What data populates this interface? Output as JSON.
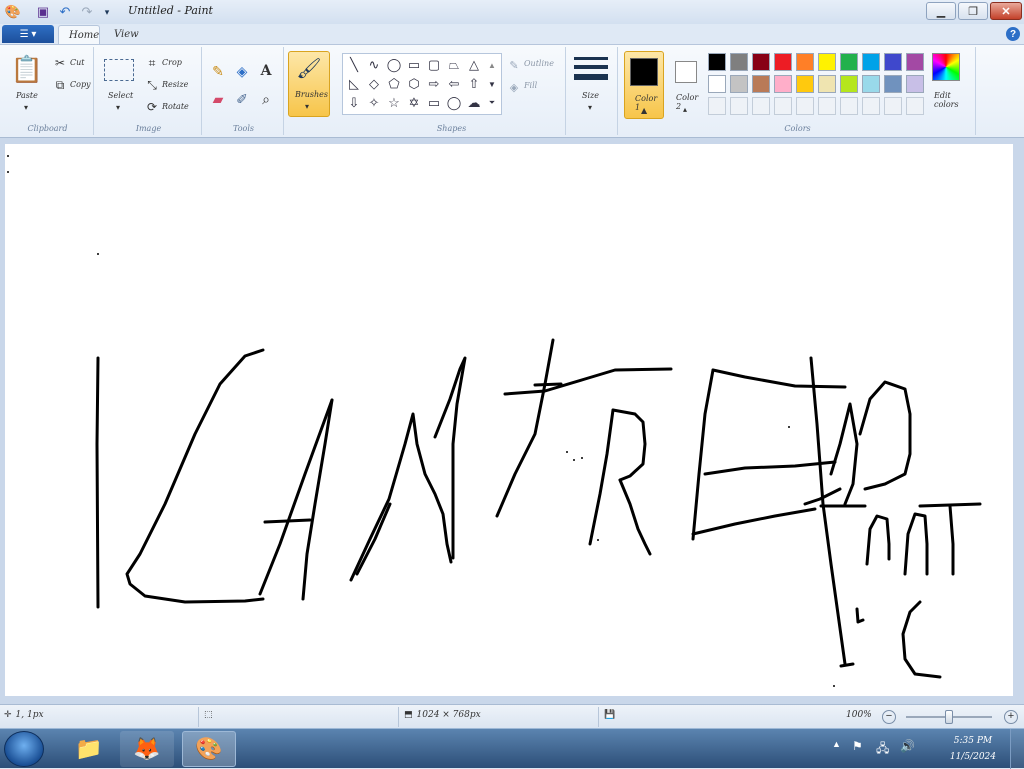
{
  "window": {
    "title": "Untitled - Paint"
  },
  "tabs": [
    {
      "label": "Home"
    },
    {
      "label": "View"
    }
  ],
  "ribbon": {
    "clipboard": {
      "paste": "Paste",
      "cut": "Cut",
      "copy": "Copy",
      "group": "Clipboard"
    },
    "image": {
      "select": "Select",
      "crop": "Crop",
      "resize": "Resize",
      "rotate": "Rotate",
      "group": "Image"
    },
    "tools": {
      "group": "Tools"
    },
    "brushes": {
      "label": "Brushes"
    },
    "shapes": {
      "outline": "Outline",
      "fill": "Fill",
      "group": "Shapes"
    },
    "size": {
      "label": "Size"
    },
    "colors": {
      "color1": "Color 1",
      "color2": "Color 2",
      "edit": "Edit colors",
      "group": "Colors",
      "palette_row1": [
        "#000000",
        "#7f7f7f",
        "#880015",
        "#ed1c24",
        "#ff7f27",
        "#fff200",
        "#22b14c",
        "#00a2e8",
        "#3f48cc",
        "#a349a4"
      ],
      "palette_row2": [
        "#ffffff",
        "#c3c3c3",
        "#b97a57",
        "#ffaec9",
        "#ffc90e",
        "#efe4b0",
        "#b5e61d",
        "#99d9ea",
        "#7092be",
        "#c8bfe7"
      ],
      "active_color1": "#000000",
      "active_color2": "#ffffff"
    }
  },
  "statusbar": {
    "cursor_pos": "1, 1px",
    "selection_size": "1024 × 768px",
    "zoom": "100%"
  },
  "taskbar": {
    "apps": [
      "Windows Explorer",
      "Firefox",
      "Paint"
    ],
    "clock_time": "5:35 PM",
    "clock_date": "11/5/2024"
  }
}
